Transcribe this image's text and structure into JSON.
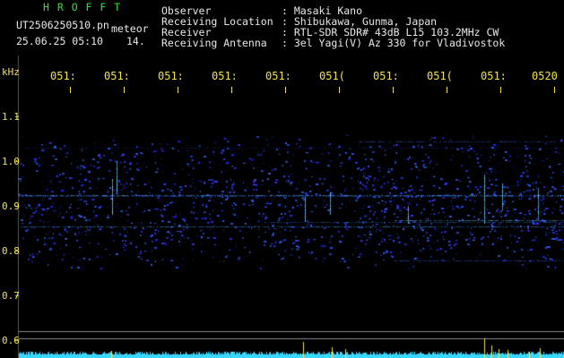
{
  "header": {
    "title": "H R O F F T",
    "filename": "UT2506250510.pn",
    "meteor_label": "meteor",
    "datetime": "25.06.25 05:10",
    "count": "14.",
    "info": [
      {
        "key": "Observer",
        "value": "Masaki Kano"
      },
      {
        "key": "Receiving Location",
        "value": "Shibukawa, Gunma, Japan"
      },
      {
        "key": "Receiver",
        "value": "RTL-SDR SDR# 43dB L15 103.2MHz CW"
      },
      {
        "key": "Receiving Antenna",
        "value": "3el Yagi(V) Az 330 for Vladivostok"
      }
    ]
  },
  "axis": {
    "unit": "kHz",
    "y_ticks": [
      "1.1",
      "1.0",
      "0.9",
      "0.8",
      "0.7",
      "0.6"
    ],
    "x_ticks": [
      "051:",
      "051:",
      "051:",
      "051:",
      "051:",
      "051(",
      "051:",
      "051(",
      "051:",
      "0520"
    ]
  },
  "colors": {
    "background": "#000000",
    "text_yellow": "#f2e34a",
    "text_white": "#e8e8e8",
    "title_green": "#35e23a",
    "signal_blue": "#2a3cff",
    "signal_cyan": "#37d7ff"
  }
}
